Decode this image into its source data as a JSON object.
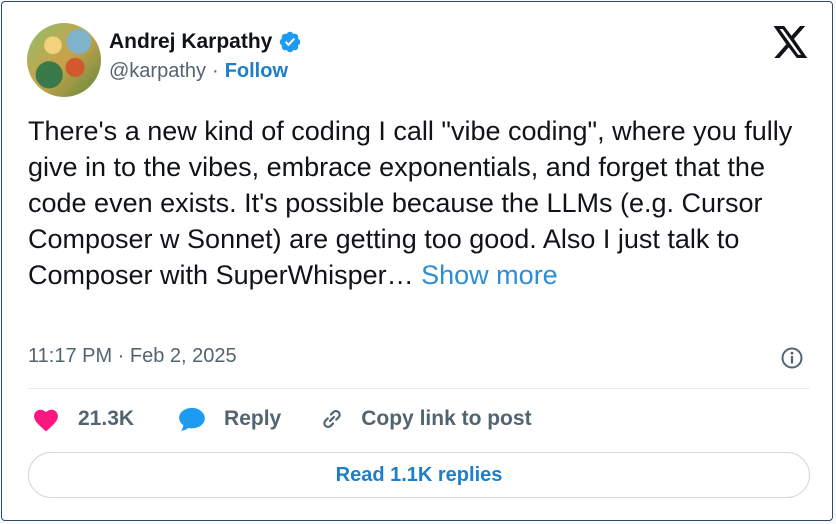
{
  "author": {
    "name": "Andrej Karpathy",
    "handle": "@karpathy",
    "separator": "·",
    "follow_label": "Follow"
  },
  "tweet": {
    "text": "There's a new kind of coding I call \"vibe coding\", where you fully give in to the vibes, embrace exponentials, and forget that the code even exists. It's possible because the LLMs (e.g. Cursor Composer w Sonnet) are getting too good. Also I just talk to Composer with SuperWhisper… ",
    "show_more_label": "Show more",
    "timestamp": "11:17 PM · Feb 2, 2025"
  },
  "actions": {
    "likes": "21.3K",
    "reply_label": "Reply",
    "copy_link_label": "Copy link to post"
  },
  "replies_button_label": "Read 1.1K replies",
  "icons": {
    "verified": "verified-badge-icon",
    "logo": "x-logo-icon",
    "info": "info-icon",
    "like": "heart-icon",
    "reply": "speech-bubble-icon",
    "link": "link-icon"
  },
  "colors": {
    "accent": "#1d7fc9",
    "heart": "#f91880",
    "verified": "#1d9bf0",
    "text": "#0f1419",
    "secondary": "#536471"
  }
}
